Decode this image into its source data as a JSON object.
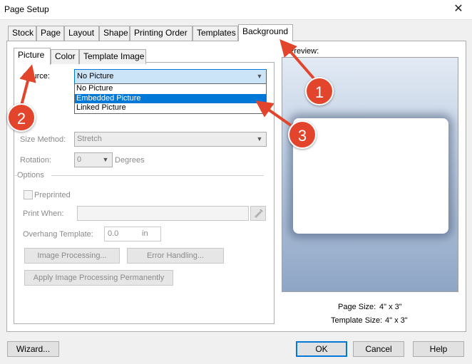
{
  "window": {
    "title": "Page Setup",
    "close_glyph": "✕"
  },
  "tabs": [
    "Stock",
    "Page",
    "Layout",
    "Shape",
    "Printing Order",
    "Templates",
    "Background"
  ],
  "subtabs": [
    "Picture",
    "Color",
    "Template Image"
  ],
  "source": {
    "label": "Source:",
    "value": "No Picture",
    "options": [
      "No Picture",
      "Embedded Picture",
      "Linked Picture"
    ],
    "highlighted": "Embedded Picture"
  },
  "size_method": {
    "label": "Size Method:",
    "value": "Stretch"
  },
  "rotation": {
    "label": "Rotation:",
    "value": "0",
    "unit": "Degrees"
  },
  "options_group": {
    "label": "Options",
    "preprinted": "Preprinted",
    "print_when": "Print When:",
    "overhang_label": "Overhang Template:",
    "overhang_value": "0.0",
    "overhang_unit": "in"
  },
  "buttons": {
    "image_processing": "Image Processing...",
    "error_handling": "Error Handling...",
    "apply_permanently": "Apply Image Processing Permanently",
    "wizard": "Wizard...",
    "ok": "OK",
    "cancel": "Cancel",
    "help": "Help"
  },
  "preview": {
    "label": "Preview:",
    "page_size_label": "Page Size:",
    "page_size_value": "4\" x 3\"",
    "template_size_label": "Template Size:",
    "template_size_value": "4\" x 3\""
  },
  "annotations": [
    "1",
    "2",
    "3"
  ],
  "colors": {
    "annotation": "#e2452b",
    "selection": "#0078d7"
  }
}
